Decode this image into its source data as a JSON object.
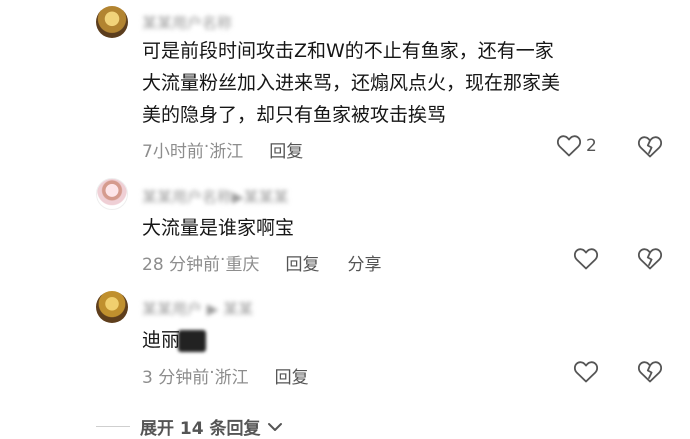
{
  "comments": [
    {
      "username": "某某用户名称",
      "body_lines": [
        "可是前段时间攻击Z和W的不止有鱼家，还有一家",
        "大流量粉丝加入进来骂，还煽风点火，现在那家美",
        "美的隐身了，却只有鱼家被攻击挨骂"
      ],
      "time": "7小时前",
      "location": "浙江",
      "reply_label": "回复",
      "like_count": "2"
    },
    {
      "username": "某某用户名称▶某某某",
      "body": "大流量是谁家啊宝",
      "time": "28 分钟前",
      "location": "重庆",
      "reply_label": "回复",
      "share_label": "分享"
    },
    {
      "username": "某某用户 ▶ 某某",
      "body": "迪丽",
      "time": "3 分钟前",
      "location": "浙江",
      "reply_label": "回复"
    }
  ],
  "separator": " · ",
  "expand_label": "展开 14 条回复",
  "icons": {
    "like": "heart-outline-icon",
    "dislike": "broken-heart-outline-icon",
    "expand": "chevron-down-icon"
  },
  "colors": {
    "text": "#161616",
    "meta": "#8d8d8d",
    "icon": "#555555"
  }
}
